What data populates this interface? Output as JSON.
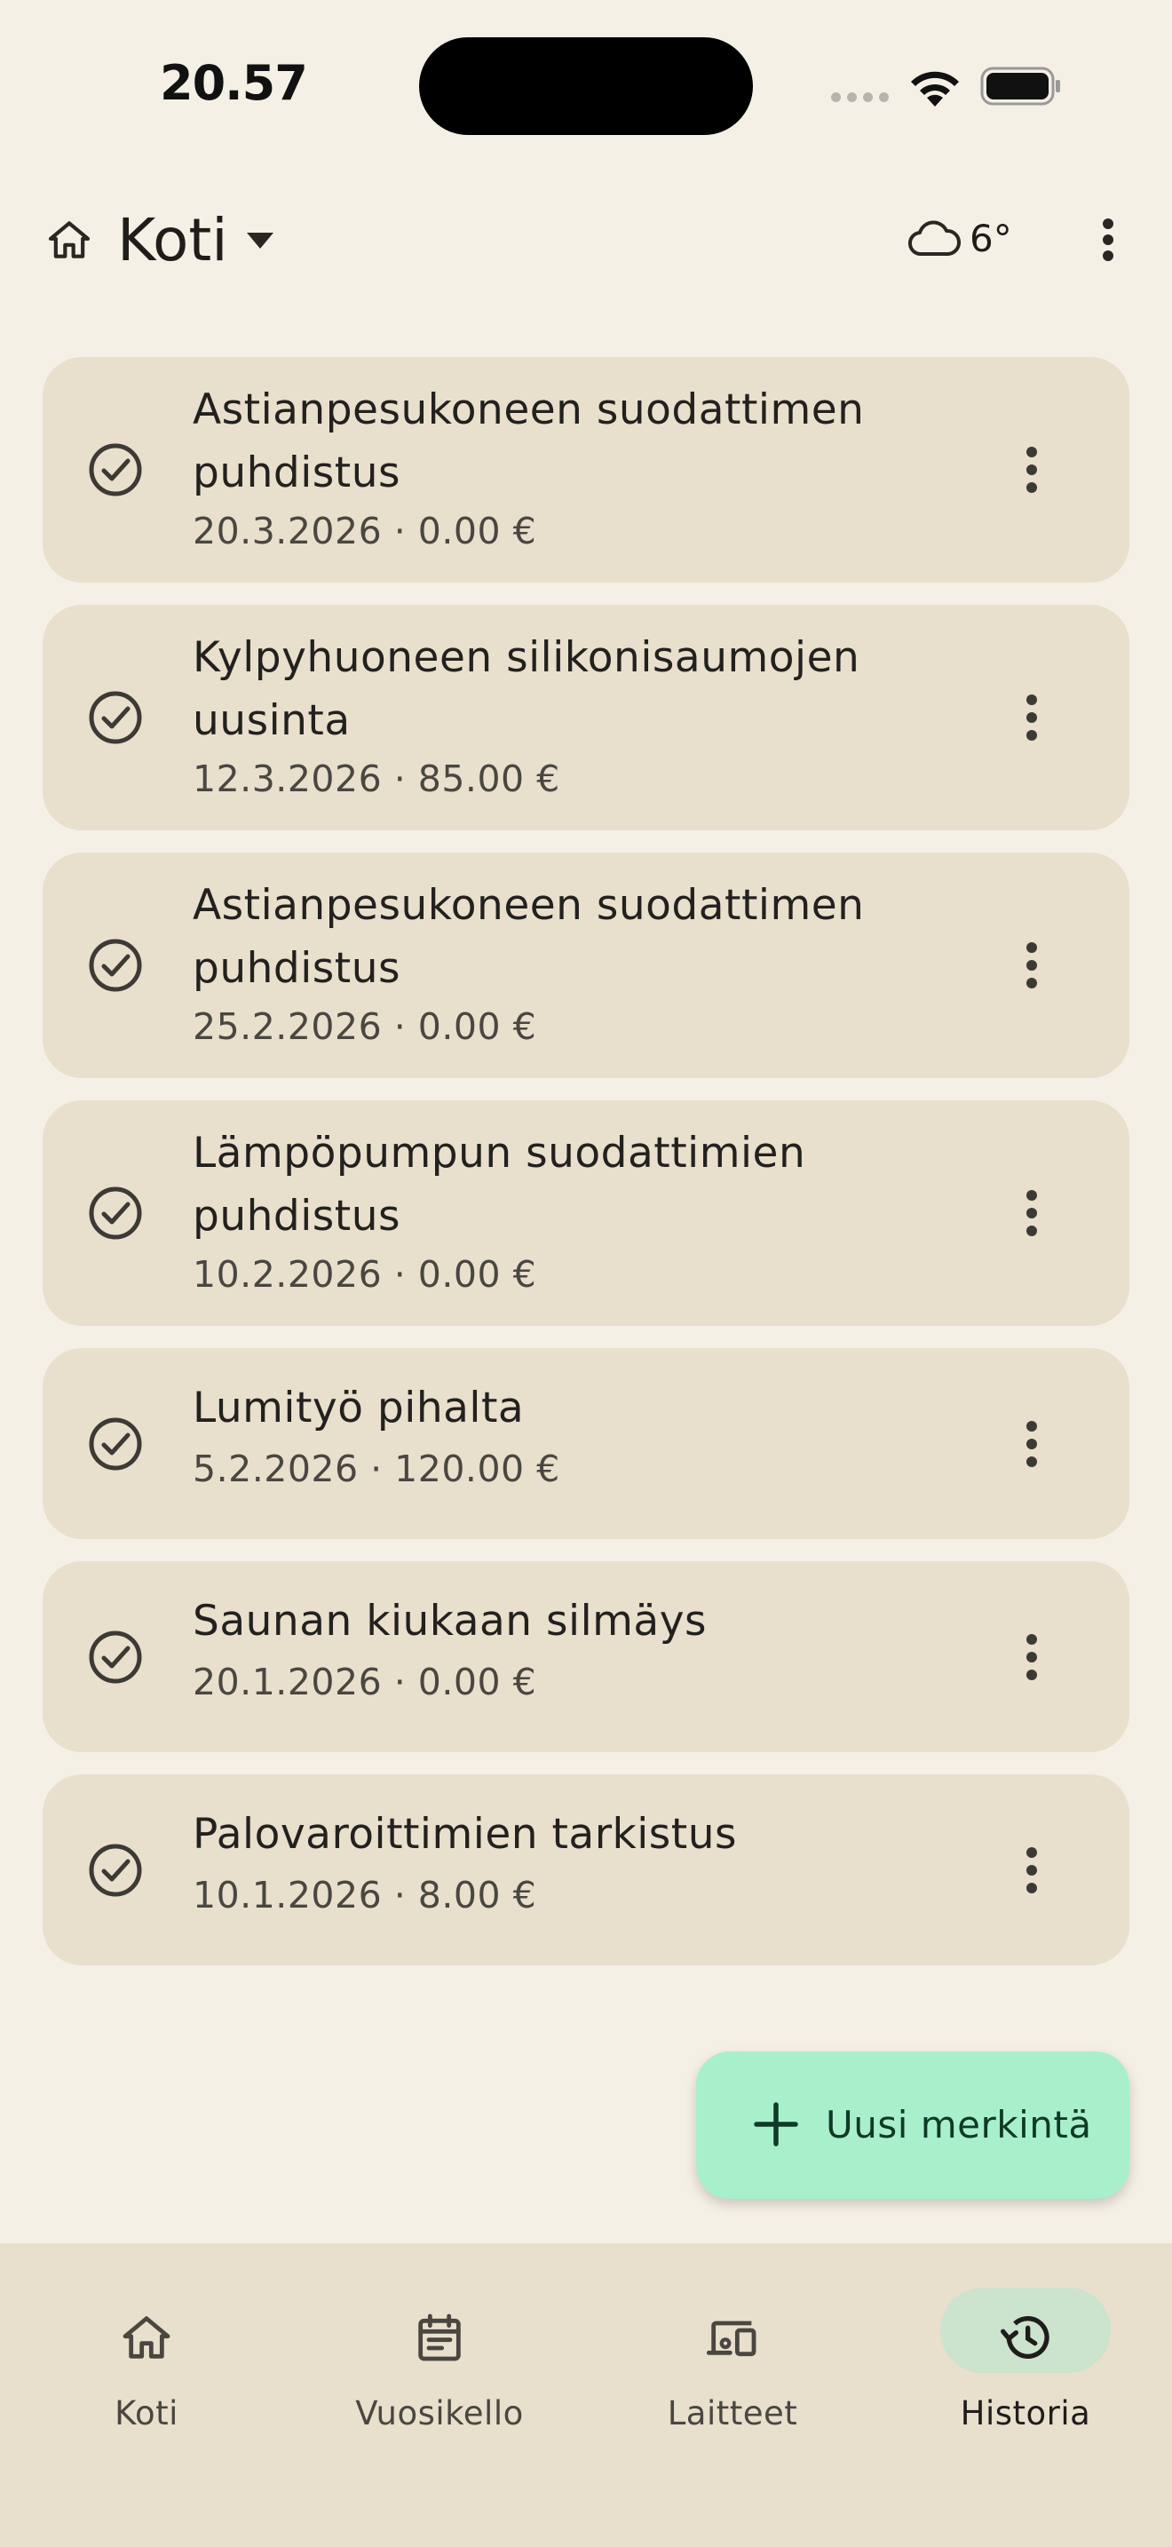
{
  "status_bar": {
    "time": "20.57"
  },
  "app_bar": {
    "title": "Koti",
    "weather_temp": "6°",
    "icons": {
      "home": "home-icon",
      "caret": "caret-down-icon",
      "weather": "cloud-icon",
      "menu": "more-vert-icon"
    }
  },
  "entries": [
    {
      "title": "Astianpesukoneen suodattimen puhdistus",
      "meta": "20.3.2026 · 0.00 €"
    },
    {
      "title": "Kylpyhuoneen silikonisaumojen uusinta",
      "meta": "12.3.2026 · 85.00 €"
    },
    {
      "title": "Astianpesukoneen suodattimen puhdistus",
      "meta": "25.2.2026 · 0.00 €"
    },
    {
      "title": "Lämpöpumpun suodattimien puhdistus",
      "meta": "10.2.2026 · 0.00 €"
    },
    {
      "title": "Lumityö pihalta",
      "meta": "5.2.2026 · 120.00 €"
    },
    {
      "title": "Saunan kiukaan silmäys",
      "meta": "20.1.2026 · 0.00 €"
    },
    {
      "title": "Palovaroittimien tarkistus",
      "meta": "10.1.2026 · 8.00 €"
    }
  ],
  "fab": {
    "label": "Uusi merkintä",
    "icon": "plus-icon"
  },
  "bottom_nav": {
    "items": [
      {
        "label": "Koti",
        "icon": "home-icon"
      },
      {
        "label": "Vuosikello",
        "icon": "calendar-icon"
      },
      {
        "label": "Laitteet",
        "icon": "devices-icon"
      },
      {
        "label": "Historia",
        "icon": "history-icon"
      }
    ],
    "active": "Historia"
  },
  "colors": {
    "background": "#F5F0E6",
    "card": "#E8DFCD",
    "fab": "#A8F0CC",
    "active_pill": "#CCE3CE",
    "text": "#1F1D1A"
  }
}
